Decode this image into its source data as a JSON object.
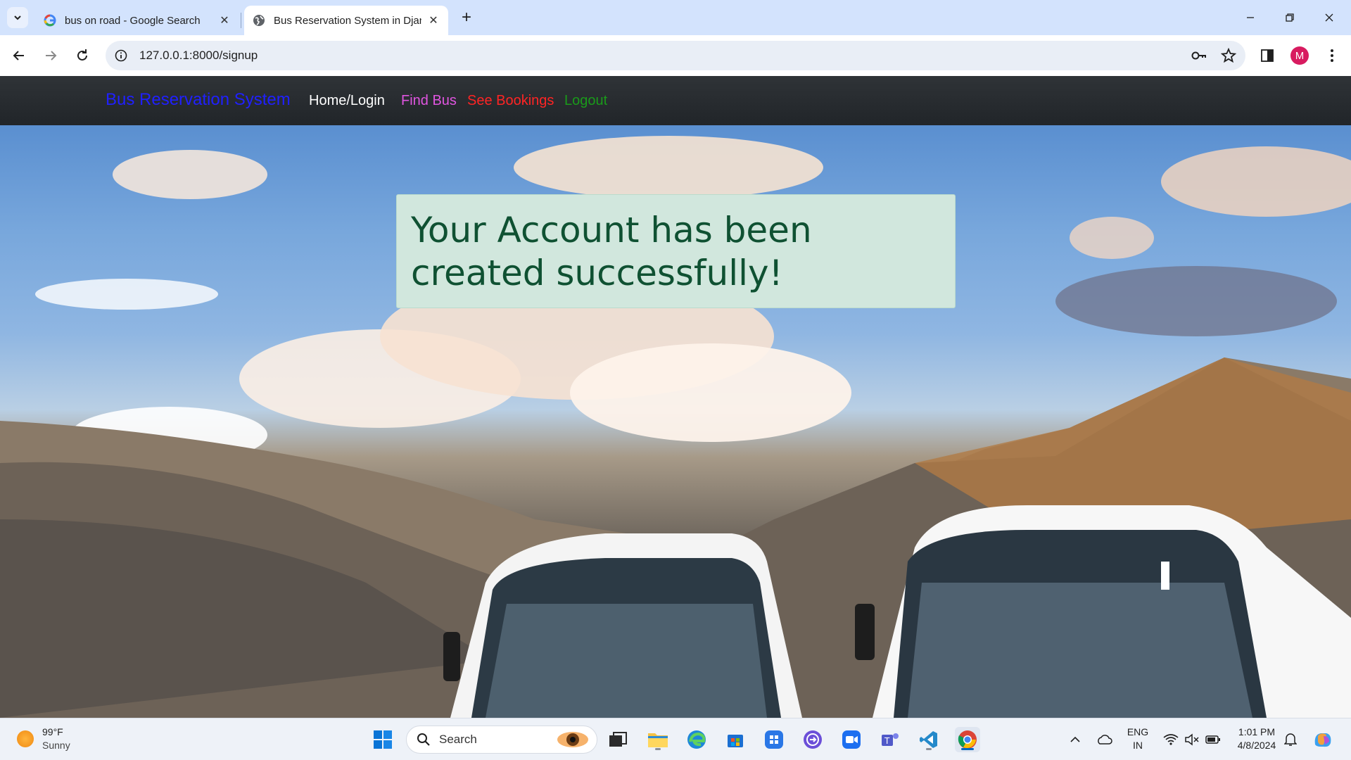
{
  "browser": {
    "tabs": [
      {
        "title": "bus on road - Google Search",
        "favicon": "google-g-icon"
      },
      {
        "title": "Bus Reservation System in Djan",
        "favicon": "globe-icon"
      }
    ],
    "url": "127.0.0.1:8000/signup"
  },
  "navbar": {
    "brand": "Bus Reservation System",
    "links": [
      {
        "label": "Home/Login",
        "color": "#ffffff"
      },
      {
        "label": "Find Bus",
        "color": "#e055e0"
      },
      {
        "label": "See Bookings",
        "color": "#ff2424"
      },
      {
        "label": "Logout",
        "color": "#1a9a1a"
      }
    ],
    "brand_color": "#2020ff"
  },
  "alert": {
    "message": "Your Account has been created successfully!"
  },
  "taskbar": {
    "weather": {
      "temp": "99°F",
      "condition": "Sunny"
    },
    "search_label": "Search",
    "language": {
      "line1": "ENG",
      "line2": "IN"
    },
    "clock": {
      "time": "1:01 PM",
      "date": "4/8/2024"
    }
  },
  "profile_initial": "M"
}
